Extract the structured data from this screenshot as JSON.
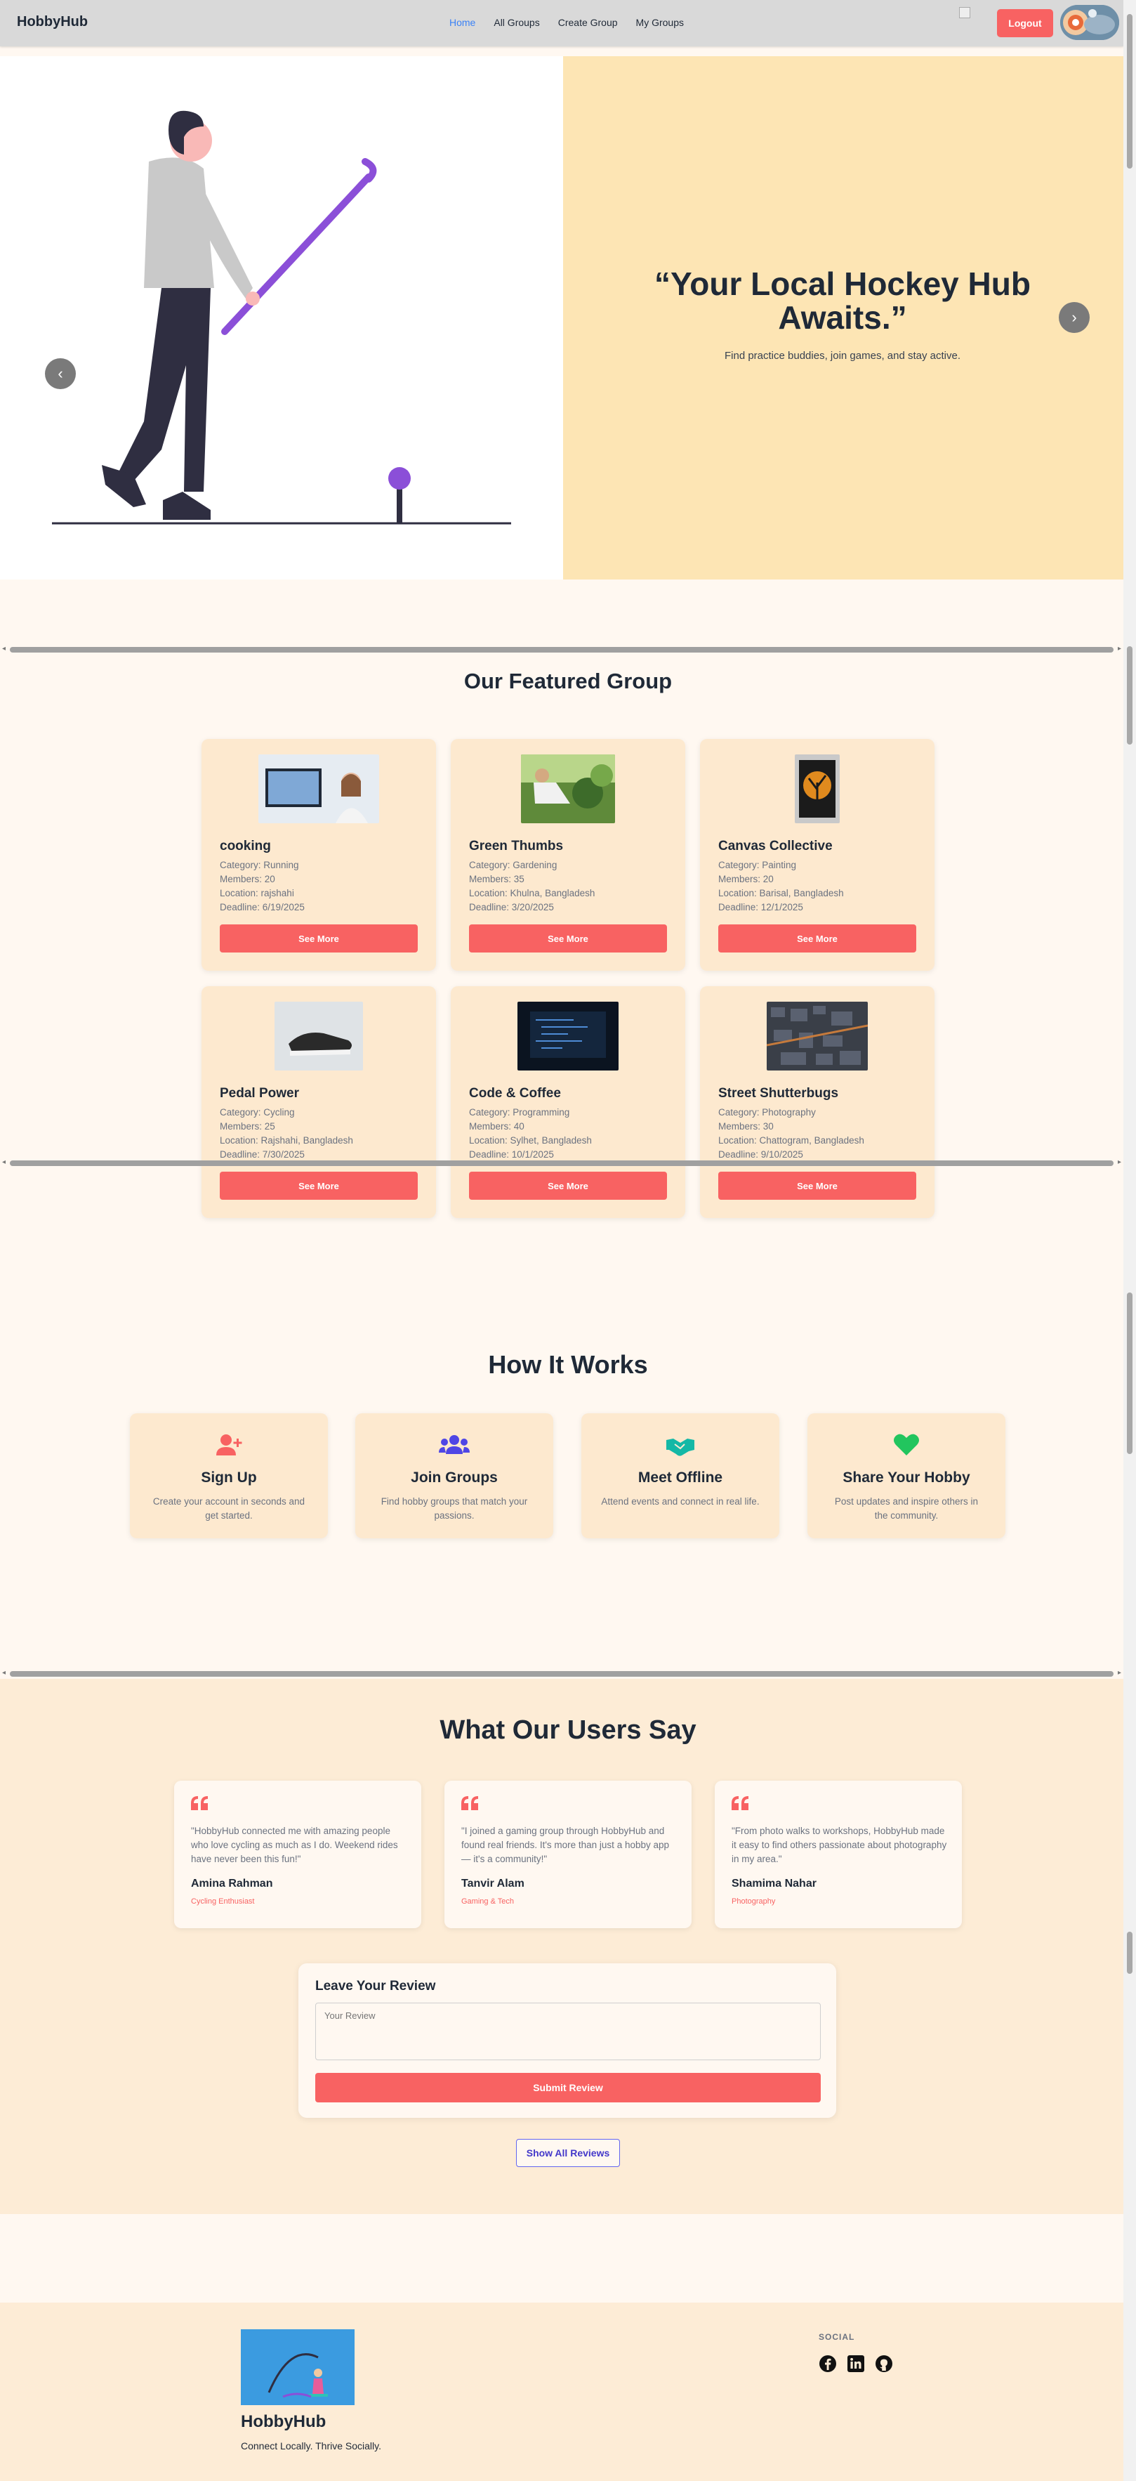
{
  "navbar": {
    "brand": "HobbyHub",
    "links": [
      "Home",
      "All Groups",
      "Create Group",
      "My Groups"
    ],
    "logout_label": "Logout"
  },
  "hero": {
    "quote": "“Your Local Hockey Hub Awaits.”",
    "subtitle": "Find practice buddies, join games, and stay active.",
    "prev_icon": "chevron-left-icon",
    "next_icon": "chevron-right-icon"
  },
  "featured": {
    "title": "Our Featured Group",
    "see_more_label": "See More",
    "groups": [
      {
        "name": "cooking",
        "category": "Category: Running",
        "members": "Members: 20",
        "location": "Location: rajshahi",
        "deadline": "Deadline: 6/19/2025"
      },
      {
        "name": "Green Thumbs",
        "category": "Category: Gardening",
        "members": "Members: 35",
        "location": "Location: Khulna, Bangladesh",
        "deadline": "Deadline: 3/20/2025"
      },
      {
        "name": "Canvas Collective",
        "category": "Category: Painting",
        "members": "Members: 20",
        "location": "Location: Barisal, Bangladesh",
        "deadline": "Deadline: 12/1/2025"
      },
      {
        "name": "Pedal Power",
        "category": "Category: Cycling",
        "members": "Members: 25",
        "location": "Location: Rajshahi, Bangladesh",
        "deadline": "Deadline: 7/30/2025"
      },
      {
        "name": "Code & Coffee",
        "category": "Category: Programming",
        "members": "Members: 40",
        "location": "Location: Sylhet, Bangladesh",
        "deadline": "Deadline: 10/1/2025"
      },
      {
        "name": "Street Shutterbugs",
        "category": "Category: Photography",
        "members": "Members: 30",
        "location": "Location: Chattogram, Bangladesh",
        "deadline": "Deadline: 9/10/2025"
      }
    ]
  },
  "how": {
    "title": "How It Works",
    "steps": [
      {
        "title": "Sign Up",
        "desc": "Create your account in seconds and get started.",
        "icon": "user-plus-icon",
        "color": "#f86262"
      },
      {
        "title": "Join Groups",
        "desc": "Find hobby groups that match your passions.",
        "icon": "users-icon",
        "color": "#4f46e5"
      },
      {
        "title": "Meet Offline",
        "desc": "Attend events and connect in real life.",
        "icon": "handshake-icon",
        "color": "#14b8a6"
      },
      {
        "title": "Share Your Hobby",
        "desc": "Post updates and inspire others in the community.",
        "icon": "heart-icon",
        "color": "#22c55e"
      }
    ]
  },
  "testimonials": {
    "title": "What Our Users Say",
    "items": [
      {
        "text": "\"HobbyHub connected me with amazing people who love cycling as much as I do. Weekend rides have never been this fun!\"",
        "name": "Amina Rahman",
        "role": "Cycling Enthusiast"
      },
      {
        "text": "\"I joined a gaming group through HobbyHub and found real friends. It's more than just a hobby app — it's a community!\"",
        "name": "Tanvir Alam",
        "role": "Gaming & Tech"
      },
      {
        "text": "\"From photo walks to workshops, HobbyHub made it easy to find others passionate about photography in my area.\"",
        "name": "Shamima Nahar",
        "role": "Photography"
      }
    ]
  },
  "review": {
    "title": "Leave Your Review",
    "placeholder": "Your Review",
    "submit_label": "Submit Review",
    "show_all_label": "Show All Reviews"
  },
  "footer": {
    "brand": "HobbyHub",
    "tagline": "Connect Locally. Thrive Socially.",
    "social_title": "SOCIAL",
    "social_icons": [
      "facebook-icon",
      "linkedin-icon",
      "github-icon"
    ]
  },
  "colors": {
    "accent": "#f86262",
    "hero_panel": "#fde5b4",
    "card": "#fde9cf",
    "page": "#fff8f1"
  }
}
